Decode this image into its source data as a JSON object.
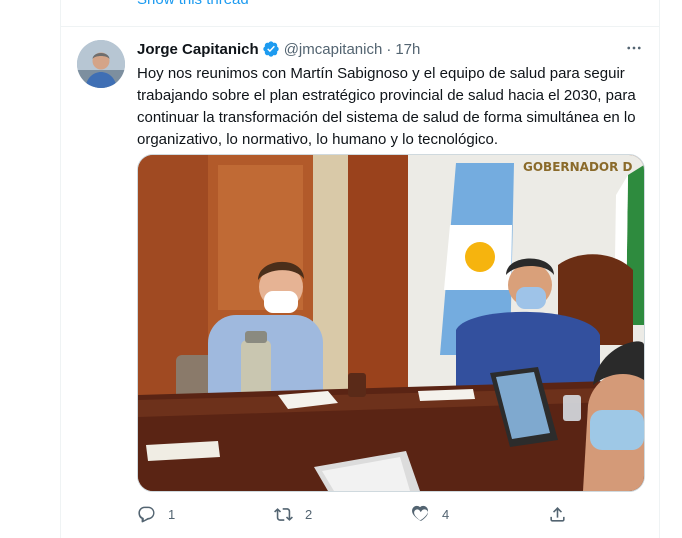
{
  "previous_tweet": {
    "show_thread": "Show this thread"
  },
  "tweet": {
    "author_name": "Jorge Capitanich",
    "handle": "@jmcapitanich",
    "separator": "·",
    "time": "17h",
    "text": "Hoy nos reunimos con Martín Sabignoso y el equipo de salud para seguir trabajando sobre el plan estratégico provincial de salud hacia el 2030, para continuar la transformación del sistema de salud de forma simultánea en lo organizativo, lo normativo, lo humano y lo tecnológico.",
    "photo_sign_text": "GOBERNADOR D",
    "reply_count": "1",
    "retweet_count": "2",
    "like_count": "4"
  },
  "icons": {
    "verified": "verified-badge-icon",
    "more": "more-options-icon",
    "reply": "reply-icon",
    "retweet": "retweet-icon",
    "like": "heart-icon",
    "share": "share-icon"
  },
  "colors": {
    "accent": "#1d9bf0",
    "text": "#0f1419",
    "muted": "#536471",
    "border": "#eff3f4"
  }
}
